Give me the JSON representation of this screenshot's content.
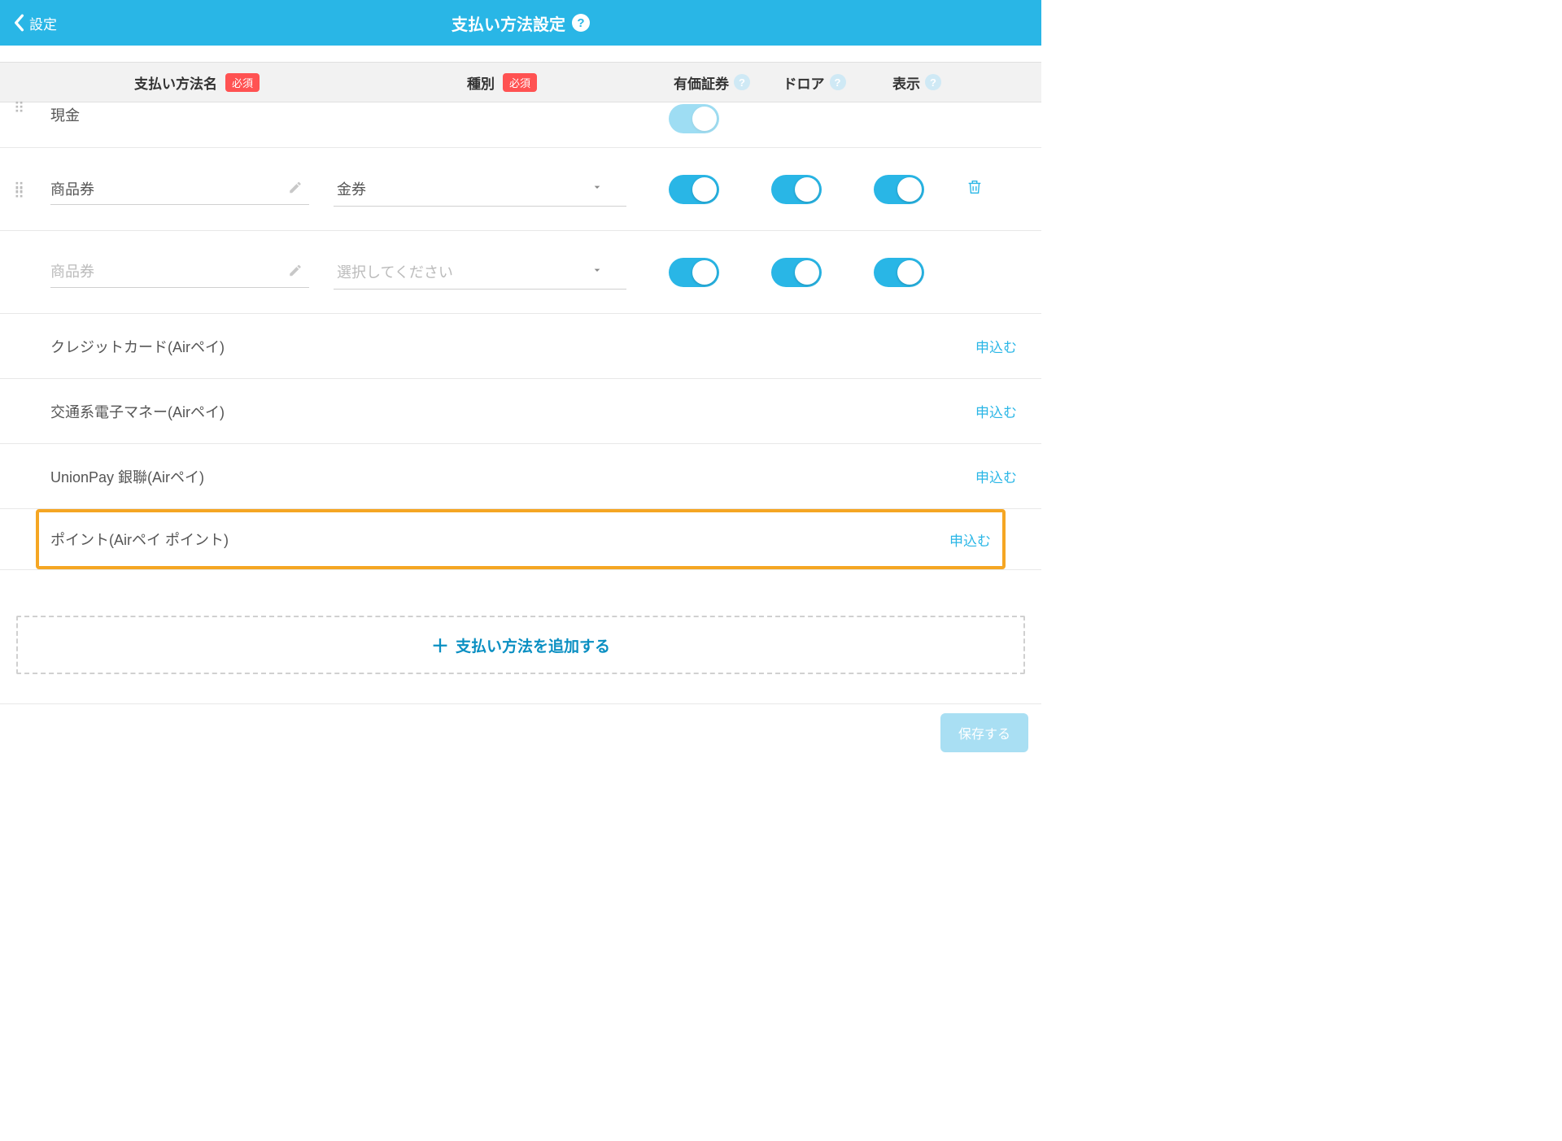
{
  "header": {
    "back_label": "設定",
    "title": "支払い方法設定"
  },
  "columns": {
    "name": "支払い方法名",
    "type": "種別",
    "securities": "有価証券",
    "drawer": "ドロア",
    "display": "表示",
    "required_badge": "必須"
  },
  "rows": {
    "cash": {
      "name": "現金"
    },
    "voucher": {
      "name": "商品券",
      "type": "金券"
    },
    "newrow": {
      "name_placeholder": "商品券",
      "type_placeholder": "選択してください"
    }
  },
  "static_rows": [
    {
      "label": "クレジットカード(Airペイ)",
      "action": "申込む"
    },
    {
      "label": "交通系電子マネー(Airペイ)",
      "action": "申込む"
    },
    {
      "label": "UnionPay 銀聯(Airペイ)",
      "action": "申込む"
    }
  ],
  "highlighted_row": {
    "label": "ポイント(Airペイ ポイント)",
    "action": "申込む"
  },
  "add_button": "支払い方法を追加する",
  "save_button": "保存する"
}
